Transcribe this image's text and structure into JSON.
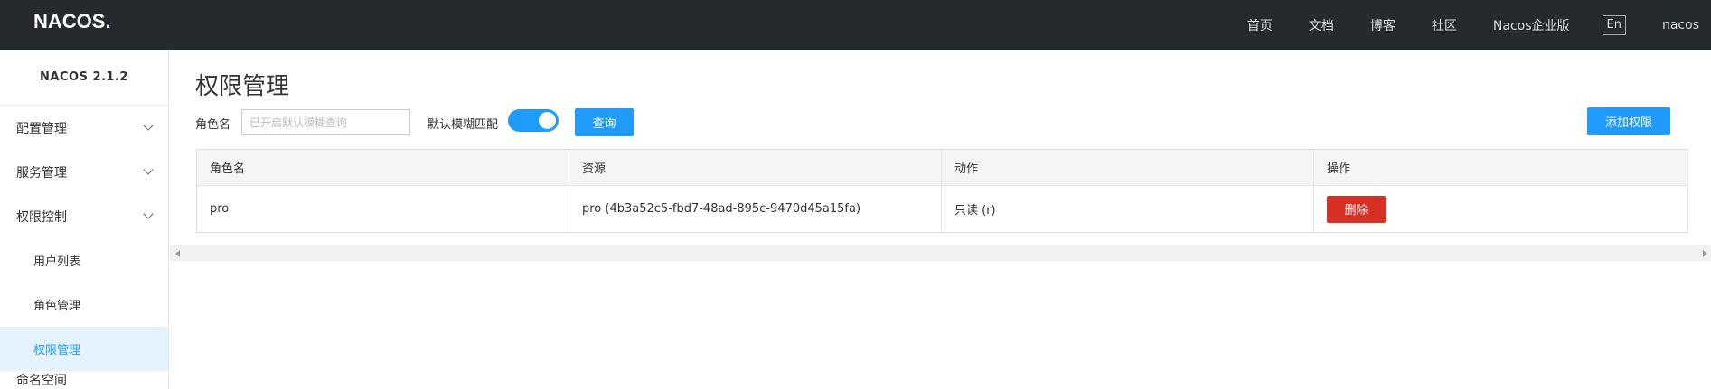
{
  "header": {
    "logo": "NACOS.",
    "nav": [
      "首页",
      "文档",
      "博客",
      "社区",
      "Nacos企业版"
    ],
    "lang": "En",
    "user": "nacos"
  },
  "sidebar": {
    "version": "NACOS 2.1.2",
    "groups": [
      "配置管理",
      "服务管理",
      "权限控制"
    ],
    "subitems": [
      "用户列表",
      "角色管理",
      "权限管理"
    ],
    "next_group_cut": "命名空间"
  },
  "main": {
    "title": "权限管理",
    "role_label": "角色名",
    "search_placeholder": "已开启默认模糊查询",
    "fuzzy_label": "默认模糊匹配",
    "query_btn": "查询",
    "add_btn": "添加权限",
    "table": {
      "headers": [
        "角色名",
        "资源",
        "动作",
        "操作"
      ],
      "rows": [
        {
          "role": "pro",
          "resource": "pro (4b3a52c5-fbd7-48ad-895c-9470d45a15fa)",
          "action": "只读 (r)",
          "op": "删除"
        }
      ]
    }
  },
  "colors": {
    "header_bg": "#252a2f",
    "primary": "#209bfa",
    "danger": "#d93026",
    "active_bg": "#e4f3fd"
  }
}
